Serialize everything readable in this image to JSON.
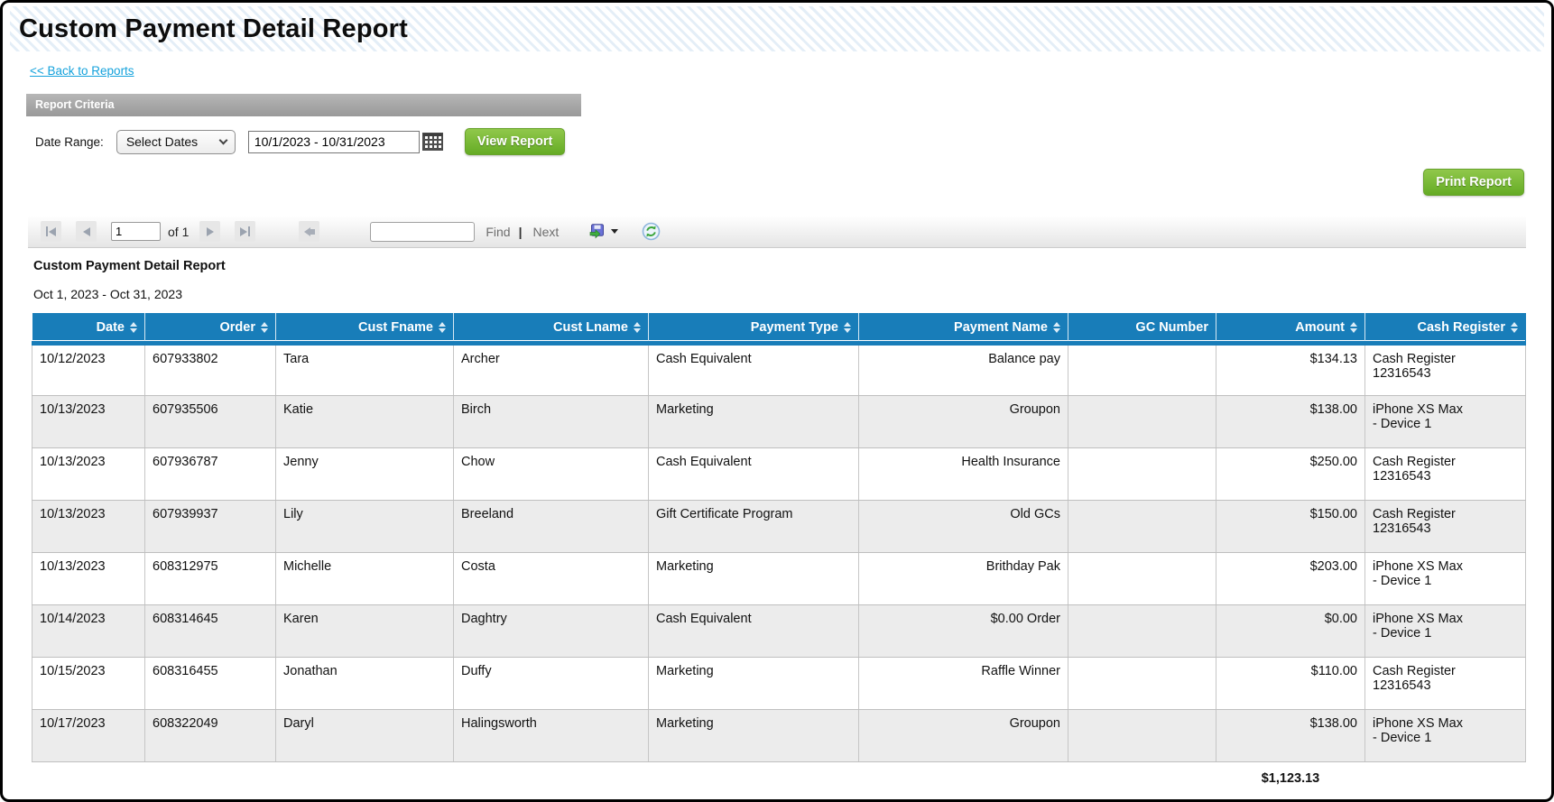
{
  "window": {
    "title": "Custom Payment Detail Report"
  },
  "nav": {
    "back_link": "<< Back to Reports"
  },
  "criteria": {
    "header": "Report Criteria",
    "date_range_label": "Date Range:",
    "date_select_value": "Select Dates",
    "date_input_value": "10/1/2023 - 10/31/2023",
    "view_report_label": "View Report"
  },
  "actions": {
    "print_report_label": "Print Report"
  },
  "toolbar": {
    "page_number": "1",
    "of_label": "of 1",
    "find_label": "Find",
    "divider": "|",
    "next_label": "Next",
    "search_value": ""
  },
  "report": {
    "title": "Custom Payment Detail Report",
    "date_range": "Oct 1, 2023 - Oct 31, 2023",
    "total_amount": "$1,123.13"
  },
  "table": {
    "columns": [
      {
        "key": "date",
        "label": "Date",
        "sortable": true,
        "align": "left"
      },
      {
        "key": "order",
        "label": "Order",
        "sortable": true,
        "align": "left"
      },
      {
        "key": "cust_fname",
        "label": "Cust Fname",
        "sortable": true,
        "align": "left"
      },
      {
        "key": "cust_lname",
        "label": "Cust Lname",
        "sortable": true,
        "align": "left"
      },
      {
        "key": "payment_type",
        "label": "Payment Type",
        "sortable": true,
        "align": "left"
      },
      {
        "key": "payment_name",
        "label": "Payment Name",
        "sortable": true,
        "align": "right"
      },
      {
        "key": "gc_number",
        "label": "GC Number",
        "sortable": false,
        "align": "left"
      },
      {
        "key": "amount",
        "label": "Amount",
        "sortable": true,
        "align": "right"
      },
      {
        "key": "cash_register",
        "label": "Cash Register",
        "sortable": true,
        "align": "left"
      }
    ],
    "rows": [
      [
        "10/12/2023",
        "607933802",
        "Tara",
        "Archer",
        "Cash Equivalent",
        "Balance pay",
        "",
        "$134.13",
        "Cash Register\n12316543"
      ],
      [
        "10/13/2023",
        "607935506",
        "Katie",
        "Birch",
        "Marketing",
        "Groupon",
        "",
        "$138.00",
        "iPhone XS Max\n- Device 1"
      ],
      [
        "10/13/2023",
        "607936787",
        "Jenny",
        "Chow",
        "Cash Equivalent",
        "Health Insurance",
        "",
        "$250.00",
        "Cash Register\n12316543"
      ],
      [
        "10/13/2023",
        "607939937",
        "Lily",
        "Breeland",
        "Gift Certificate Program",
        "Old GCs",
        "",
        "$150.00",
        "Cash Register\n12316543"
      ],
      [
        "10/13/2023",
        "608312975",
        "Michelle",
        "Costa",
        "Marketing",
        "Brithday Pak",
        "",
        "$203.00",
        "iPhone XS Max\n- Device 1"
      ],
      [
        "10/14/2023",
        "608314645",
        "Karen",
        "Daghtry",
        "Cash Equivalent",
        "$0.00 Order",
        "",
        "$0.00",
        "iPhone XS Max\n- Device 1"
      ],
      [
        "10/15/2023",
        "608316455",
        "Jonathan",
        "Duffy",
        "Marketing",
        "Raffle Winner",
        "",
        "$110.00",
        "Cash Register\n12316543"
      ],
      [
        "10/17/2023",
        "608322049",
        "Daryl",
        "Halingsworth",
        "Marketing",
        "Groupon",
        "",
        "$138.00",
        "iPhone XS Max\n- Device 1"
      ]
    ]
  },
  "colors": {
    "header_blue": "#187db9",
    "button_green": "#76b82a",
    "link_blue": "#14a2dc",
    "alt_row_gray": "#ececec",
    "criteria_bar_gray": "#a5a5a5"
  }
}
